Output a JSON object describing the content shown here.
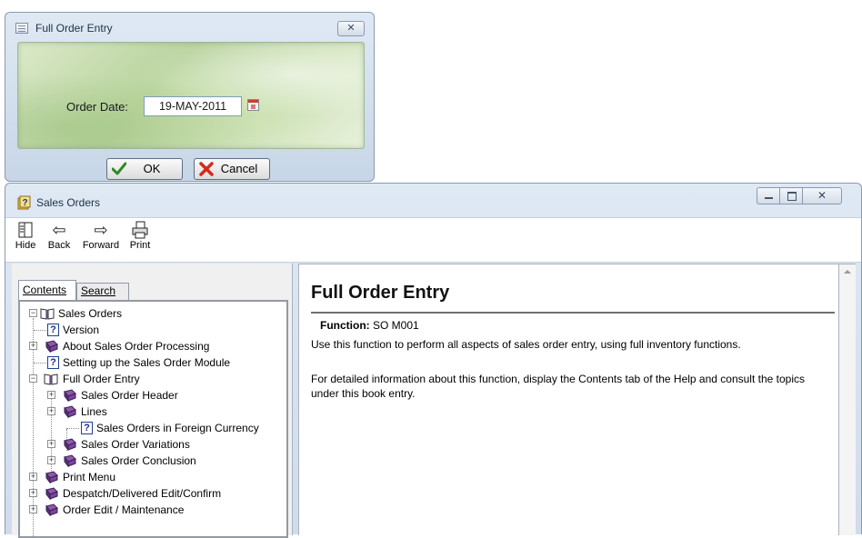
{
  "dialog": {
    "title": "Full Order Entry",
    "close_glyph": "✕",
    "order_date_label": "Order Date:",
    "order_date_value": "19-MAY-2011",
    "ok_label": "OK",
    "cancel_label": "Cancel"
  },
  "help": {
    "title": "Sales Orders",
    "toolbar": {
      "hide": "Hide",
      "back": "Back",
      "forward": "Forward",
      "print": "Print"
    },
    "tabs": {
      "contents": "Contents",
      "search": "Search"
    },
    "tree": {
      "sales_orders": "Sales Orders",
      "version": "Version",
      "about": "About Sales Order Processing",
      "setting_up": "Setting up the Sales Order Module",
      "full_order_entry": "Full Order Entry",
      "header": "Sales Order Header",
      "lines": "Lines",
      "foreign": "Sales Orders in Foreign Currency",
      "variations": "Sales Order Variations",
      "conclusion": "Sales Order Conclusion",
      "print_menu": "Print Menu",
      "despatch": "Despatch/Delivered Edit/Confirm",
      "order_edit": "Order Edit / Maintenance"
    },
    "content": {
      "heading": "Full Order Entry",
      "function_label": "Function:",
      "function_value": "SO M001",
      "para1": "Use this function to perform all aspects of sales order entry, using full inventory functions.",
      "para2": "For detailed information about this function, display the Contents tab of the Help and consult the topics under this book entry."
    }
  }
}
